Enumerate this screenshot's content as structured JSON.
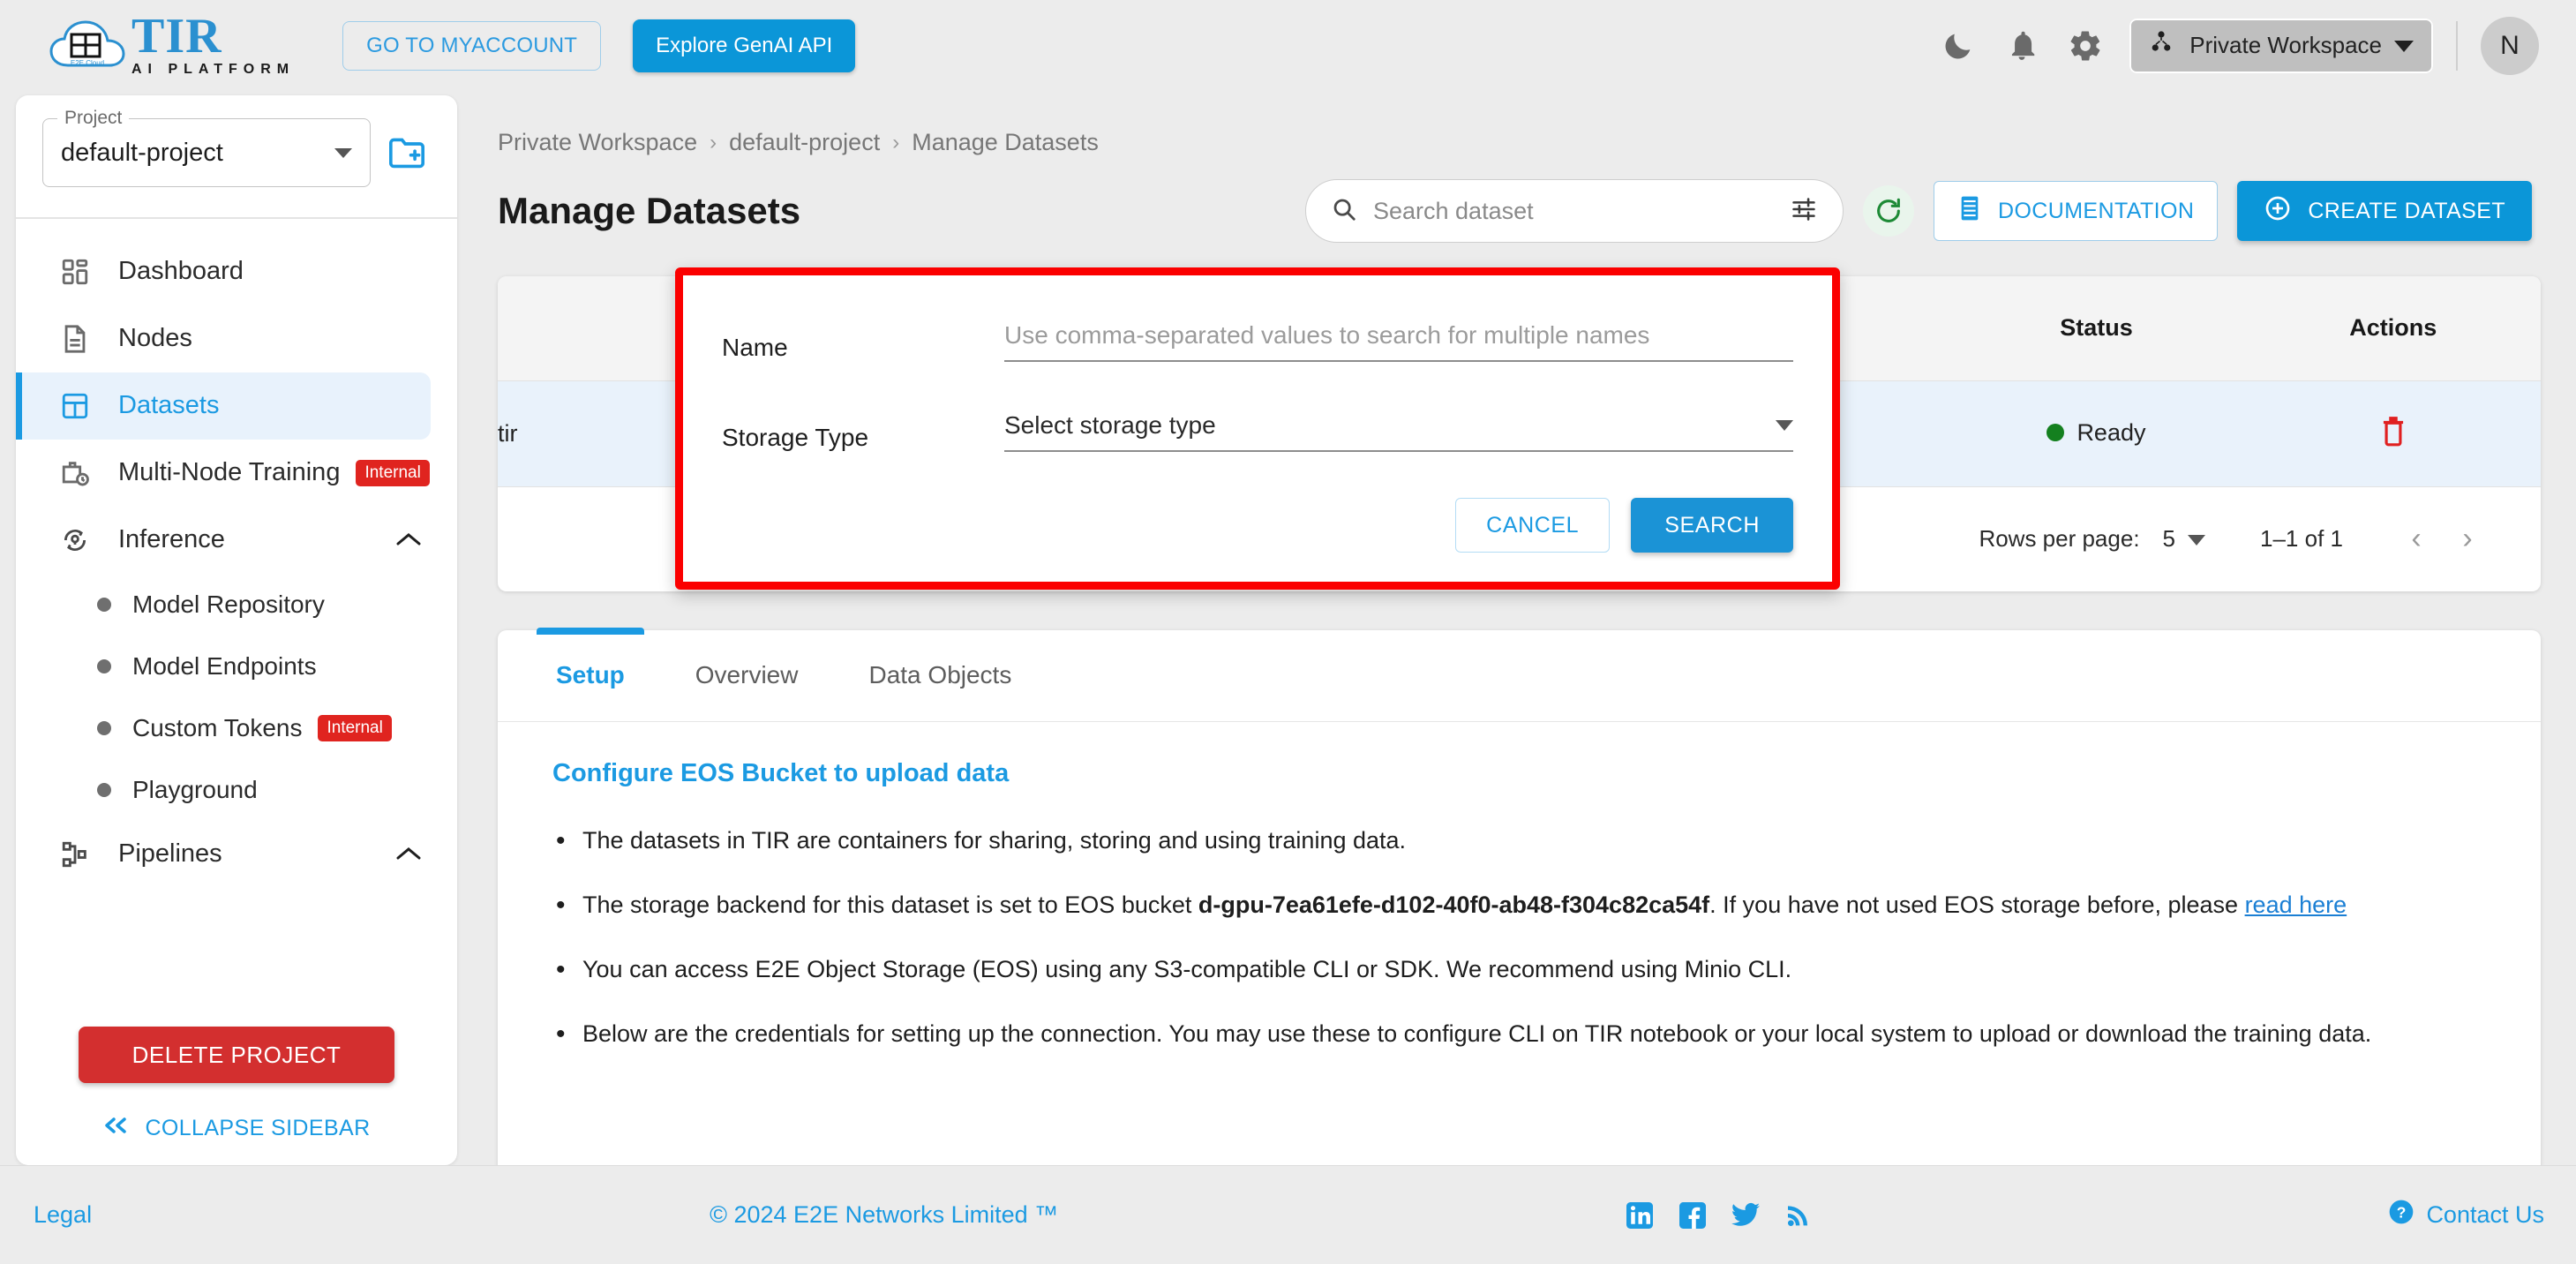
{
  "topbar": {
    "logo_title": "TIR",
    "logo_sub": "AI PLATFORM",
    "logo_badge": "E2E Cloud",
    "myaccount_label": "GO TO MYACCOUNT",
    "genai_label": "Explore GenAI API",
    "dark_mode_icon": "moon-icon",
    "notifications_icon": "bell-icon",
    "settings_icon": "gear-icon",
    "workspace_label": "Private Workspace",
    "workspace_icon": "workspace-group-icon",
    "avatar_initial": "N"
  },
  "sidebar": {
    "project_legend": "Project",
    "project_value": "default-project",
    "new_project_icon": "new-folder-icon",
    "items": [
      {
        "label": "Dashboard",
        "icon": "dashboard-grid-icon",
        "badge": "",
        "active": false,
        "expandable": false
      },
      {
        "label": "Nodes",
        "icon": "document-icon",
        "badge": "",
        "active": false,
        "expandable": false
      },
      {
        "label": "Datasets",
        "icon": "datasets-grid-icon",
        "badge": "",
        "active": true,
        "expandable": false
      },
      {
        "label": "Multi-Node Training",
        "icon": "briefcase-clock-icon",
        "badge": "Internal",
        "active": false,
        "expandable": false
      },
      {
        "label": "Inference",
        "icon": "inference-icon",
        "badge": "",
        "active": false,
        "expandable": true
      }
    ],
    "inference_children": [
      {
        "label": "Model Repository",
        "badge": ""
      },
      {
        "label": "Model Endpoints",
        "badge": ""
      },
      {
        "label": "Custom Tokens",
        "badge": "Internal"
      },
      {
        "label": "Playground",
        "badge": ""
      }
    ],
    "pipelines": {
      "label": "Pipelines",
      "icon": "pipelines-icon",
      "expandable": true
    },
    "delete_project_label": "DELETE PROJECT",
    "collapse_label": "COLLAPSE SIDEBAR",
    "collapse_icon": "double-chevron-left-icon"
  },
  "breadcrumb": {
    "items": [
      "Private Workspace",
      "default-project",
      "Manage Datasets"
    ],
    "separator": "›"
  },
  "page": {
    "title": "Manage Datasets"
  },
  "search": {
    "placeholder": "Search dataset",
    "value": "",
    "search_icon": "search-icon",
    "filter_icon": "tune-filter-icon"
  },
  "actions": {
    "refresh_icon": "refresh-icon",
    "documentation_label": "DOCUMENTATION",
    "documentation_icon": "book-icon",
    "create_dataset_label": "CREATE DATASET",
    "create_dataset_icon": "plus-circle-icon"
  },
  "table": {
    "columns": [
      "",
      "Status",
      "Actions"
    ],
    "status_header": "Status",
    "actions_header": "Actions",
    "rows": [
      {
        "name": "tir",
        "status": "Ready",
        "status_color": "#14801f",
        "delete_icon": "trash-icon"
      }
    ]
  },
  "pagination": {
    "rows_per_page_label": "Rows per page:",
    "rows_per_page_value": "5",
    "range_label": "1–1 of 1",
    "prev_icon": "chevron-left-icon",
    "next_icon": "chevron-right-icon"
  },
  "tabs": {
    "items": [
      {
        "label": "Setup",
        "active": true
      },
      {
        "label": "Overview",
        "active": false
      },
      {
        "label": "Data Objects",
        "active": false
      }
    ]
  },
  "setup": {
    "title": "Configure EOS Bucket to upload data",
    "bullets": [
      {
        "text": "The datasets in TIR are containers for sharing, storing and using training data."
      },
      {
        "prefix": "The storage backend for this dataset is set to EOS bucket ",
        "bold": "d-gpu-7ea61efe-d102-40f0-ab48-f304c82ca54f",
        "middle": ". If you have not used EOS storage before, please ",
        "link": "read here"
      },
      {
        "text": "You can access E2E Object Storage (EOS) using any S3-compatible CLI or SDK. We recommend using Minio CLI."
      },
      {
        "text": "Below are the credentials for setting up the connection. You may use these to configure CLI on TIR notebook or your local system to upload or download the training data."
      }
    ]
  },
  "modal": {
    "name_label": "Name",
    "name_placeholder": "Use comma-separated values to search for multiple names",
    "name_value": "",
    "storage_label": "Storage Type",
    "storage_value": "Select storage type",
    "cancel_label": "CANCEL",
    "search_label": "SEARCH",
    "highlight_color": "#fb0000"
  },
  "footer": {
    "legal": "Legal",
    "copyright": "© 2024 E2E Networks Limited ™",
    "socials": [
      "linkedin-icon",
      "facebook-icon",
      "twitter-icon",
      "rss-icon"
    ],
    "contact": "Contact Us",
    "contact_icon": "help-circle-icon"
  }
}
